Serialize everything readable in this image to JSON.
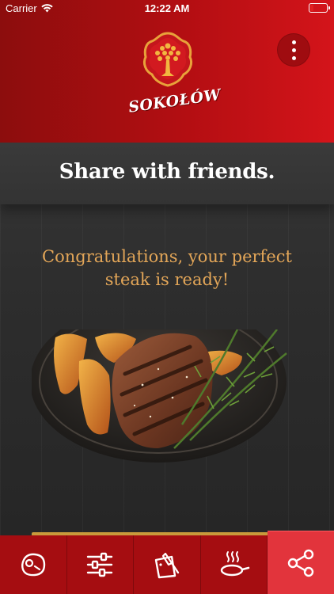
{
  "status_bar": {
    "carrier": "Carrier",
    "time": "12:22 AM",
    "battery_color": "#e02020"
  },
  "header": {
    "brand": "SOKOŁÓW",
    "logo_icon": "sokolow-tree-emblem",
    "menu_icon": "more-vertical-icon"
  },
  "main": {
    "title": "Share with friends.",
    "message": "Congratulations, your perfect steak is ready!",
    "image": "steak-plate-image"
  },
  "tabbar": {
    "items": [
      {
        "icon": "steak-icon",
        "active": false
      },
      {
        "icon": "sliders-icon",
        "active": false
      },
      {
        "icon": "cutting-board-icon",
        "active": false
      },
      {
        "icon": "frying-pan-icon",
        "active": false
      },
      {
        "icon": "share-icon",
        "active": true
      }
    ]
  },
  "colors": {
    "header_red": "#b30e12",
    "accent_gold": "#e3a658",
    "tab_active": "#e2343c"
  }
}
